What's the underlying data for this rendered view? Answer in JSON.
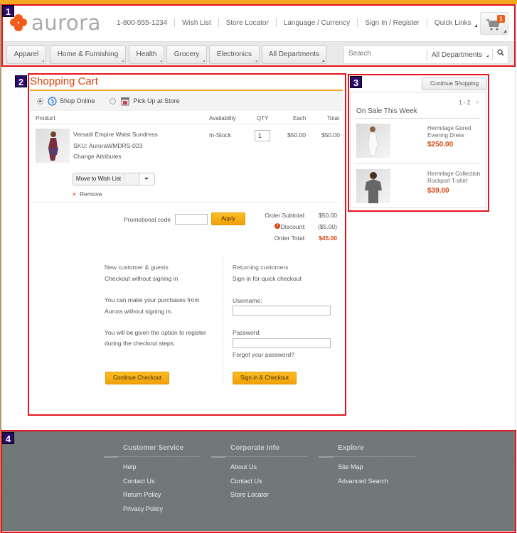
{
  "annotations": [
    "1",
    "2",
    "3",
    "4"
  ],
  "header": {
    "logo_text": "aurora",
    "phone": "1-800-555-1234",
    "links": [
      "Wish List",
      "Store Locator",
      "Language / Currency",
      "Sign In / Register"
    ],
    "quick_links": "Quick Links",
    "cart_count": "1",
    "nav": [
      "Apparel",
      "Home & Furnishing",
      "Health",
      "Grocery",
      "Electronics",
      "All Departments"
    ],
    "search_placeholder": "Search",
    "search_department": "All Departments"
  },
  "cart": {
    "title": "Shopping Cart",
    "shipping": {
      "online": "Shop Online",
      "pickup": "Pick Up at Store",
      "selected": "online"
    },
    "columns": {
      "product": "Product",
      "availability": "Availability",
      "qty": "QTY",
      "each": "Each",
      "total": "Total"
    },
    "item": {
      "name": "Versatil Empire Waist Sundress",
      "sku": "SKU: AuroraWMDRS-023",
      "change": "Change Attributes",
      "availability": "In-Stock",
      "qty": "1",
      "each": "$50.00",
      "total": "$50.00",
      "move_to_wishlist": "Move to Wish List",
      "remove": "Remove"
    },
    "promo": {
      "label": "Promotional code",
      "value": "",
      "apply": "Apply"
    },
    "summary": {
      "subtotal_label": "Order Subtotal:",
      "subtotal": "$50.00",
      "discount_label": "Discount:",
      "discount": "($5.00)",
      "total_label": "Order Total:",
      "total": "$45.00"
    },
    "guest": {
      "heading": "New customer & guests",
      "sub": "Checkout without signing in",
      "p1a": "You can make your purchases from",
      "p1b": "Aurora without signing in.",
      "p2a": "You will be given the option to register",
      "p2b": "during the checkout steps.",
      "button": "Continue Checkout"
    },
    "returning": {
      "heading": "Returning customers",
      "sub": "Sign in for quick checkout",
      "username_label": "Username:",
      "username_value": "",
      "password_label": "Password:",
      "password_value": "",
      "forgot": "Forgot your password?",
      "button": "Sign in & Checkout"
    }
  },
  "side": {
    "continue_shopping": "Continue Shopping",
    "pagination": "1 - 2",
    "title": "On Sale This Week",
    "products": [
      {
        "name1": "Hermitage Gored",
        "name2": "Evening Dress",
        "price": "$250.00"
      },
      {
        "name1": "Hermitage Collection",
        "name2": "Rockport T-shirt",
        "price": "$39.00"
      }
    ]
  },
  "footer": {
    "columns": [
      {
        "title": "Customer Service",
        "links": [
          "Help",
          "Contact Us",
          "Return Policy",
          "Privacy Policy"
        ]
      },
      {
        "title": "Corporate Info",
        "links": [
          "About Us",
          "Contact Us",
          "Store Locator"
        ]
      },
      {
        "title": "Explore",
        "links": [
          "Site Map",
          "Advanced Search"
        ]
      }
    ]
  },
  "colors": {
    "accent": "#f25c19",
    "highlight": "#e8141c",
    "button": "#f5a623",
    "footer": "#6e7676",
    "link": "#2b7bc7"
  }
}
